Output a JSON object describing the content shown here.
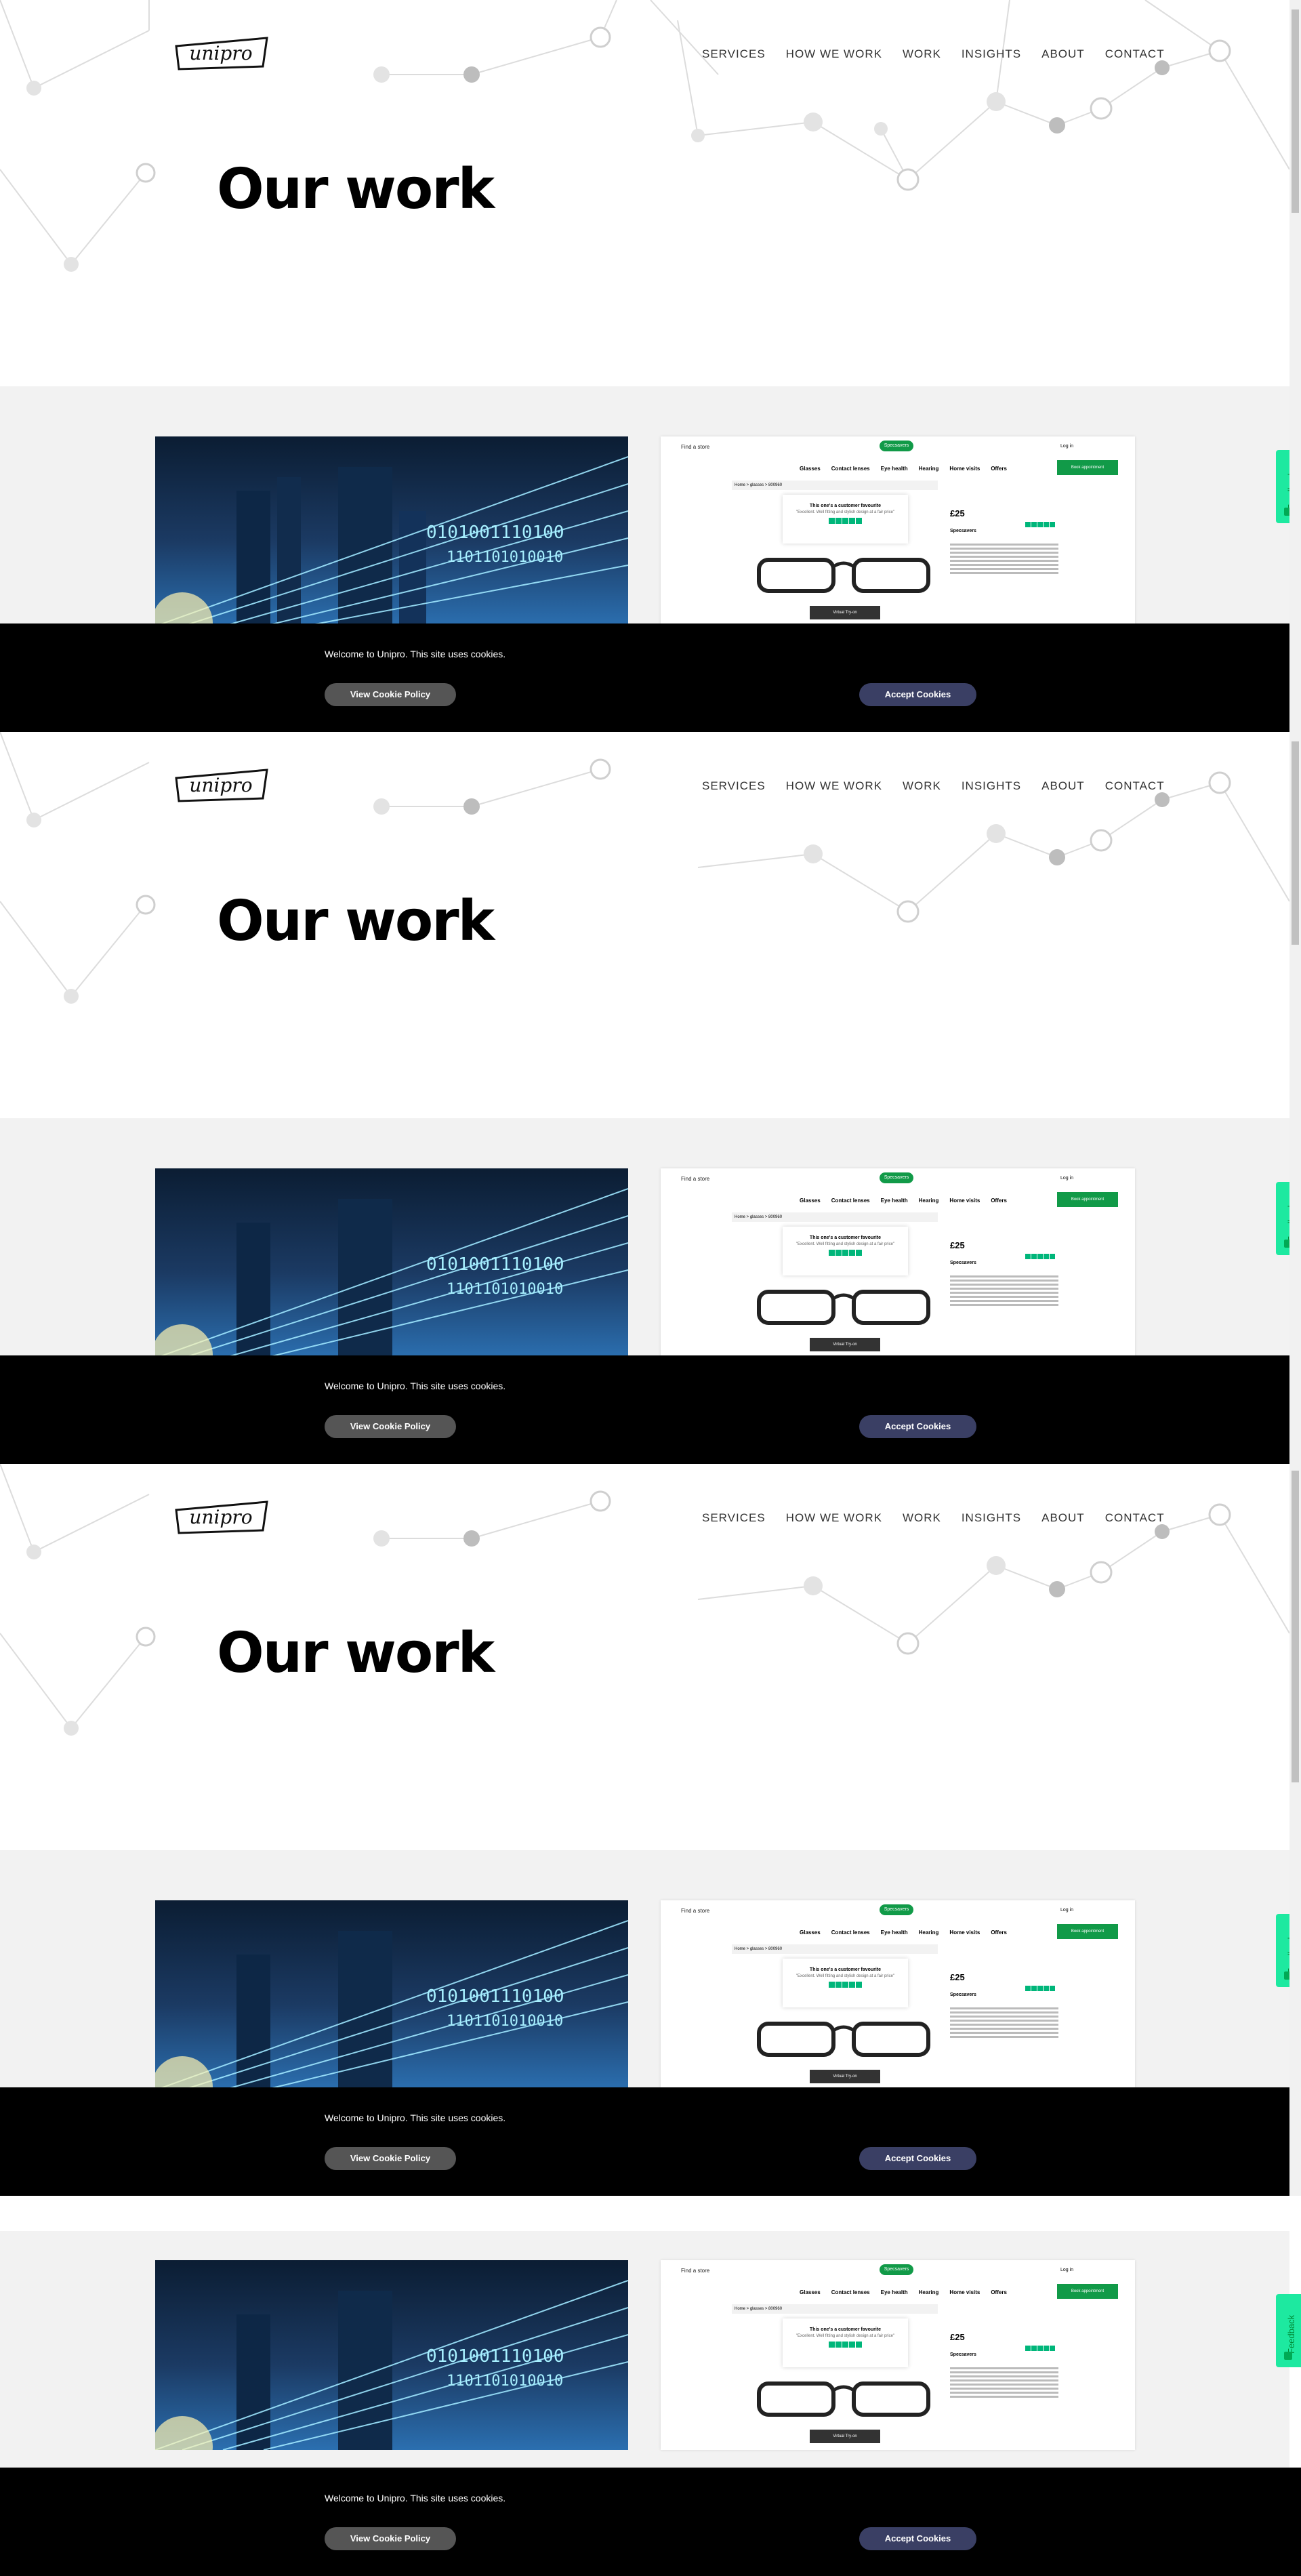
{
  "header": {
    "logo_text": "unipro",
    "nav": [
      "SERVICES",
      "HOW WE WORK",
      "WORK",
      "INSIGHTS",
      "ABOUT",
      "CONTACT"
    ]
  },
  "hero": {
    "title": "Our work"
  },
  "cookie_banner": {
    "message": "Welcome to Unipro. This site uses cookies.",
    "view_label": "View Cookie Policy",
    "accept_label": "Accept Cookies"
  },
  "feedback": {
    "label": "Feedback"
  },
  "shop_card": {
    "find_store": "Find a store",
    "brand": "Specsavers",
    "login": "Log in",
    "nav": [
      "Glasses",
      "Contact lenses",
      "Eye health",
      "Hearing",
      "Home visits",
      "Offers"
    ],
    "book_label": "Book appointment",
    "breadcrumb": "Home > glasses > 800960",
    "popup_title": "This one's a customer favourite",
    "popup_sub": "\"Excellent. Well fitting and stylish design at a fair price\"",
    "price": "£25",
    "product_name": "Specsavers",
    "try_on": "Virtual Try-on"
  },
  "colors": {
    "cookie_bg": "#000000",
    "accept_bg": "#3a3f64",
    "view_bg": "#555555",
    "feedback_bg": "#1de9a0",
    "shop_green": "#119a48",
    "section_gray": "#f2f2f2"
  }
}
